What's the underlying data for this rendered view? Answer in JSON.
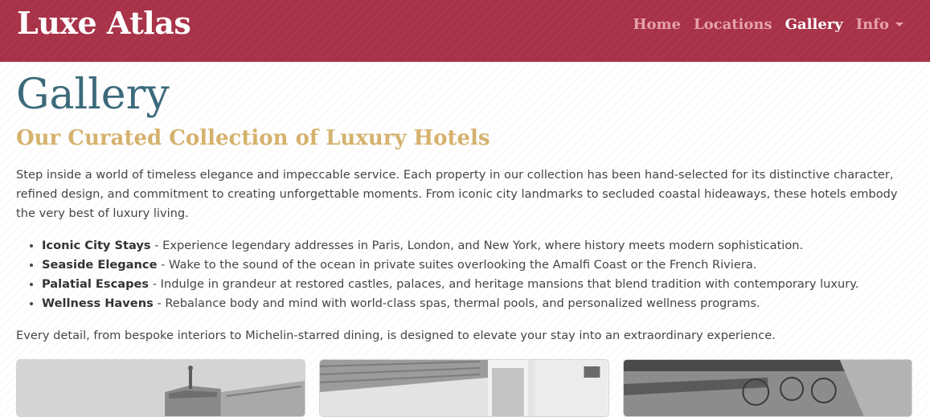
{
  "navbar": {
    "brand": "Luxe Atlas",
    "items": [
      {
        "label": "Home"
      },
      {
        "label": "Locations"
      },
      {
        "label": "Gallery"
      },
      {
        "label": "Info"
      }
    ]
  },
  "main": {
    "title": "Gallery",
    "subtitle": "Our Curated Collection of Luxury Hotels",
    "intro": "Step inside a world of timeless elegance and impeccable service. Each property in our collection has been hand-selected for its distinctive character, refined design, and commitment to creating unforgettable moments. From iconic city landmarks to secluded coastal hideaways, these hotels embody the very best of luxury living.",
    "features": [
      {
        "name": "Iconic City Stays",
        "text": " - Experience legendary addresses in Paris, London, and New York, where history meets modern sophistication."
      },
      {
        "name": "Seaside Elegance",
        "text": " - Wake to the sound of the ocean in private suites overlooking the Amalfi Coast or the French Riviera."
      },
      {
        "name": "Palatial Escapes",
        "text": " - Indulge in grandeur at restored castles, palaces, and heritage mansions that blend tradition with contemporary luxury."
      },
      {
        "name": "Wellness Havens",
        "text": " - Rebalance body and mind with world-class spas, thermal pools, and personalized wellness programs."
      }
    ],
    "outro": "Every detail, from bespoke interiors to Michelin-starred dining, is designed to elevate your stay into an extraordinary experience."
  },
  "colors": {
    "navbar": "#a83248",
    "title": "#3c6a7b",
    "subtitle": "#d5b26d"
  }
}
